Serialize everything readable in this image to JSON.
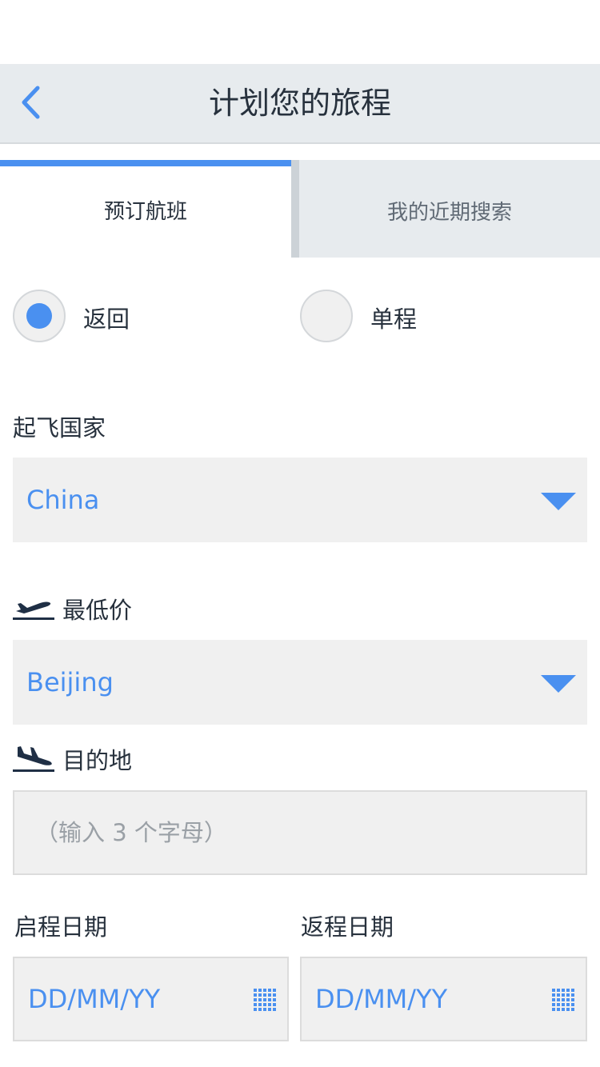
{
  "header": {
    "title": "计划您的旅程",
    "back_icon": "chevron-left-icon"
  },
  "tabs": [
    {
      "label": "预订航班",
      "active": true
    },
    {
      "label": "我的近期搜索",
      "active": false
    }
  ],
  "trip_type": {
    "options": [
      {
        "label": "返回",
        "selected": true
      },
      {
        "label": "单程",
        "selected": false
      }
    ]
  },
  "departure_country": {
    "label": "起飞国家",
    "value": "China"
  },
  "origin": {
    "label": "最低价",
    "value": "Beijing",
    "icon": "plane-takeoff-icon"
  },
  "destination": {
    "label": "目的地",
    "placeholder": "（输入 3 个字母）",
    "icon": "plane-landing-icon"
  },
  "dates": {
    "depart_label": "启程日期",
    "return_label": "返程日期",
    "depart_placeholder": "DD/MM/YY",
    "return_placeholder": "DD/MM/YY"
  },
  "colors": {
    "accent": "#4a90f0",
    "header_bg": "#e7ebee",
    "field_bg": "#f0f0f0",
    "text_dark": "#27313d"
  }
}
